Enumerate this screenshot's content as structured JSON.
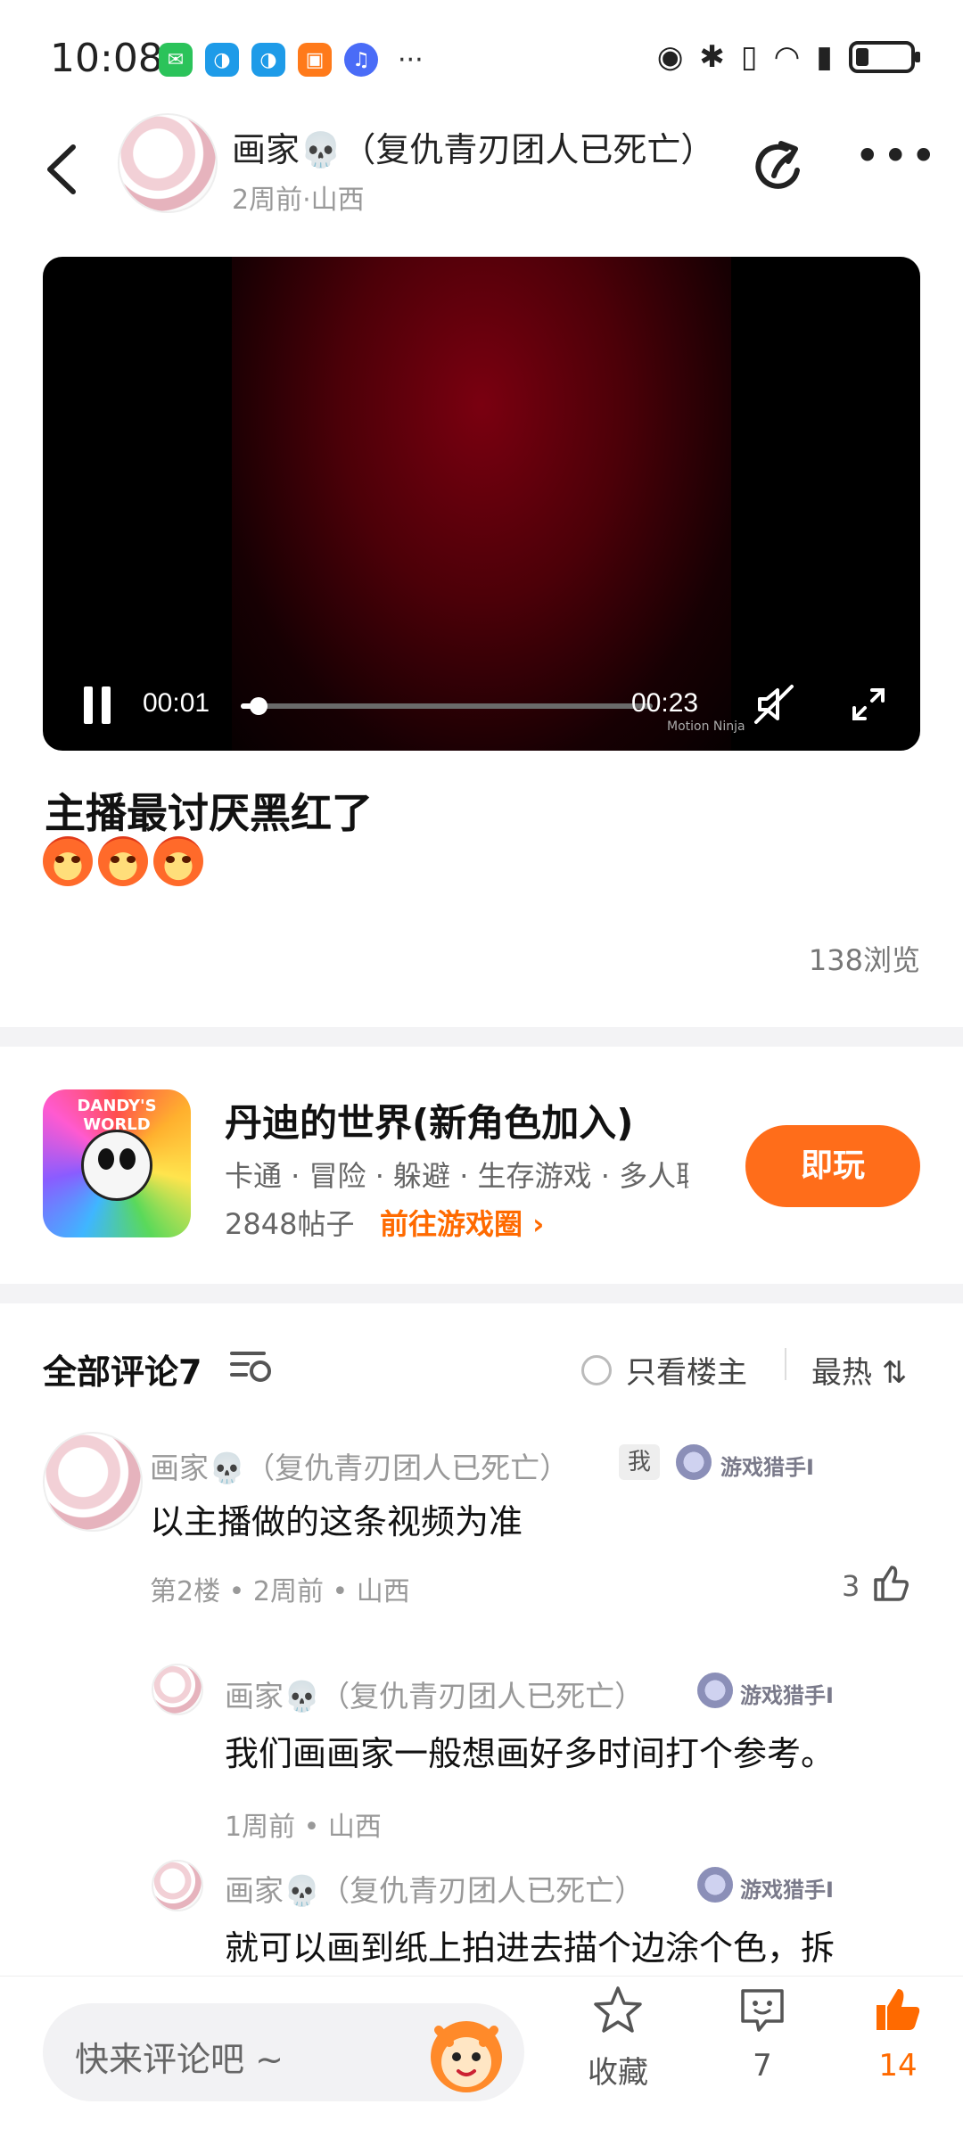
{
  "status_bar": {
    "time": "10:08",
    "ellipsis": "···"
  },
  "header": {
    "title": "画家💀（复仇青刃团人已死亡）",
    "subtitle": "2周前·山西",
    "more": "•••"
  },
  "video": {
    "current_time": "00:01",
    "duration": "00:23",
    "progress_fraction": 0.043,
    "watermark": "Motion Ninja",
    "glow_color": "#7a0010"
  },
  "post": {
    "title": "主播最讨厌黑红了",
    "views": "138浏览"
  },
  "game": {
    "name": "丹迪的世界(新角色加入)",
    "logo_text": "DANDY'S WORLD",
    "tags": "卡通 · 冒险 · 躲避 · 生存游戏 · 多人联机",
    "posts": "2848帖子",
    "link": "前往游戏圈 ›",
    "play_label": "即玩",
    "accent": "#ff6d1a"
  },
  "comments_header": {
    "title": "全部评论7",
    "op_only": "只看楼主",
    "sort": "最热 ⇅"
  },
  "comments": [
    {
      "name": "画家💀（复仇青刃团人已死亡）",
      "badge": "我",
      "rank": "游戏猎手I",
      "text": "以主播做的这条视频为准",
      "meta": "第2楼 • 2周前 • 山西",
      "likes": "3"
    }
  ],
  "replies": [
    {
      "name": "画家💀（复仇青刃团人已死亡）",
      "rank": "游戏猎手I",
      "text": "我们画画家一般想画好多时间打个参考。",
      "meta": "1周前 • 山西"
    },
    {
      "name": "画家💀（复仇青刃团人已死亡）",
      "rank": "游戏猎手I",
      "text": "就可以画到纸上拍进去描个边涂个色，拆",
      "meta": ""
    }
  ],
  "bottom_bar": {
    "placeholder": "快来评论吧 ~",
    "favorite_label": "收藏",
    "reply_count": "7",
    "like_count": "14",
    "like_color": "#ff6a00"
  }
}
